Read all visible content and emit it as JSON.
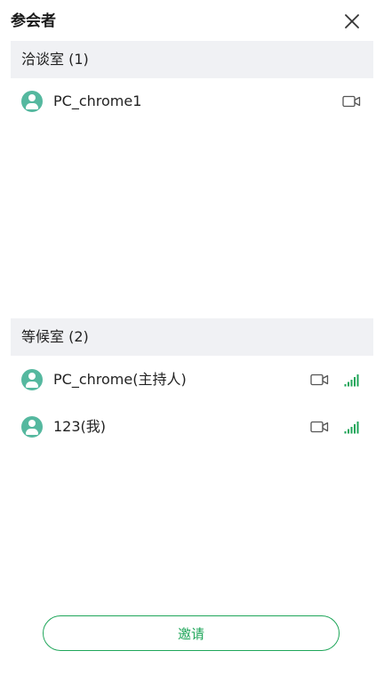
{
  "header": {
    "title": "参会者",
    "close_icon": "close-icon"
  },
  "sections": [
    {
      "title": "洽谈室 (1)",
      "participants": [
        {
          "name": "PC_chrome1",
          "icons": [
            "camera-icon"
          ]
        }
      ]
    },
    {
      "title": "等候室 (2)",
      "participants": [
        {
          "name": "PC_chrome(主持人)",
          "icons": [
            "camera-icon",
            "signal-icon"
          ]
        },
        {
          "name": "123(我)",
          "icons": [
            "camera-icon",
            "signal-icon"
          ]
        }
      ]
    }
  ],
  "invite_button": {
    "label": "邀请"
  },
  "colors": {
    "accent": "#1fa65a",
    "avatar": "#55b89f",
    "section_bg": "#f0f1f4",
    "icon_gray": "#555555"
  }
}
